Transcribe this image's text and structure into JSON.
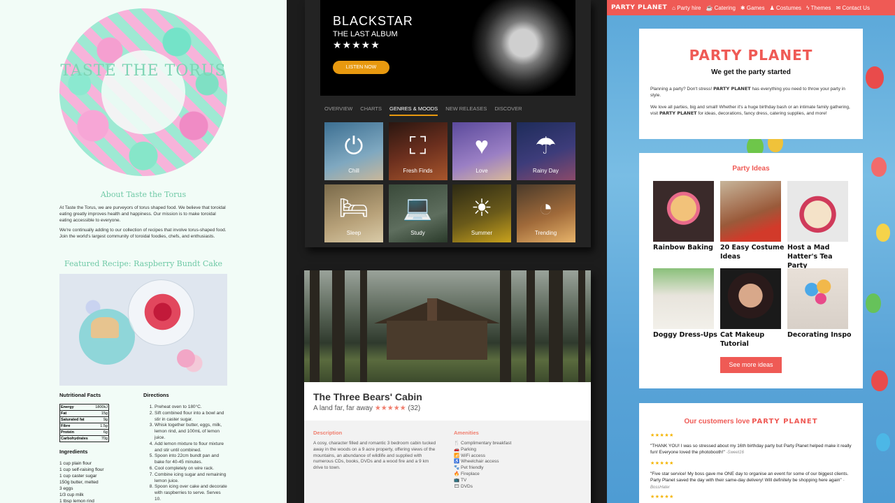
{
  "torus": {
    "hero_title": "TASTE THE TORUS",
    "about_heading": "About Taste the Torus",
    "about_p1": "At Taste the Torus, we are purveyors of torus shaped food. We believe that toroidal eating greatly improves health and happiness. Our mission is to make toroidal eating accessible to everyone.",
    "about_p2": "We're continually adding to our collection of recipes that involve torus-shaped food. Join the world's largest community of toroidal foodies, chefs, and enthusiasts.",
    "featured_heading": "Featured Recipe: Raspberry Bundt Cake",
    "nutrition_title": "Nutritional Facts",
    "nutrition": [
      {
        "label": "Energy",
        "value": "1800kJ"
      },
      {
        "label": "Fat",
        "value": "15g"
      },
      {
        "label": "Saturated fat",
        "value": "9g"
      },
      {
        "label": "Fibre",
        "value": "1.5g"
      },
      {
        "label": "Protein",
        "value": "6g"
      },
      {
        "label": "Carbohydrates",
        "value": "70g"
      }
    ],
    "ingredients_title": "Ingredients",
    "ingredients": [
      "1 cup plain flour",
      "1 cup self-raising flour",
      "1 cup caster sugar",
      "150g butter, melted",
      "3 eggs",
      "1/3 cup milk",
      "1 tbsp lemon rind"
    ],
    "directions_title": "Directions",
    "directions": [
      "Preheat oven to 180°C.",
      "Sift combined flour into a bowl and stir in caster sugar.",
      "Whisk together butter, eggs, milk, lemon rind, and 100mL of lemon juice.",
      "Add lemon mixture to flour mixture and stir until combined.",
      "Spoon into 22cm bundt pan and bake for 40-45 minutes.",
      "Cool completely on wire rack.",
      "Combine icing sugar and remaining lemon juice.",
      "Spoon icing over cake and decorate with raspberries to serve. Serves 10."
    ]
  },
  "music": {
    "album_title": "BLACKSTAR",
    "album_sub": "THE LAST ALBUM",
    "album_stars": "★★★★★",
    "listen_label": "LISTEN NOW",
    "tabs": [
      "OVERVIEW",
      "CHARTS",
      "GENRES & MOODS",
      "NEW RELEASES",
      "DISCOVER"
    ],
    "active_tab": "GENRES & MOODS",
    "accent": "#e8990f",
    "tiles": [
      {
        "label": "Chill",
        "icon": "power-icon",
        "glyph": "⏻"
      },
      {
        "label": "Fresh Finds",
        "icon": "binoculars-icon",
        "glyph": "⛶"
      },
      {
        "label": "Love",
        "icon": "heart-icon",
        "glyph": "♥"
      },
      {
        "label": "Rainy Day",
        "icon": "umbrella-icon",
        "glyph": "☂"
      },
      {
        "label": "Sleep",
        "icon": "bed-icon",
        "glyph": "🛏"
      },
      {
        "label": "Study",
        "icon": "laptop-icon",
        "glyph": "💻"
      },
      {
        "label": "Summer",
        "icon": "sun-icon",
        "glyph": "☀"
      },
      {
        "label": "Trending",
        "icon": "gauge-icon",
        "glyph": "◔"
      }
    ]
  },
  "cabin": {
    "name": "The Three Bears' Cabin",
    "tagline": "A land far, far away",
    "rating_stars": "★★★★★",
    "rating_count": "(32)",
    "description_title": "Description",
    "description": "A cosy, character filled and romantic 3 bedroom cabin tucked away in the woods on a 9 acre property, offering views of the mountains, an abundance of wildlife and supplied with numerous CDs, books, DVDs and a wood fire and a 9 km drive to town.",
    "amenities_title": "Amenities",
    "amenities": [
      {
        "label": "Complimentary breakfast",
        "icon": "cutlery-icon",
        "glyph": "🍴"
      },
      {
        "label": "Parking",
        "icon": "car-icon",
        "glyph": "🚗"
      },
      {
        "label": "WiFi access",
        "icon": "wifi-icon",
        "glyph": "📶"
      },
      {
        "label": "Wheelchair access",
        "icon": "wheelchair-icon",
        "glyph": "♿"
      },
      {
        "label": "Pet friendly",
        "icon": "paw-icon",
        "glyph": "🐾"
      },
      {
        "label": "Fireplace",
        "icon": "fire-icon",
        "glyph": "🔥"
      },
      {
        "label": "TV",
        "icon": "tv-icon",
        "glyph": "📺"
      },
      {
        "label": "DVDs",
        "icon": "film-icon",
        "glyph": "🎞"
      }
    ],
    "accent": "#f07e6e"
  },
  "party": {
    "brand": "PARTY PLANET",
    "nav": [
      {
        "label": "Party hire",
        "icon": "building-icon",
        "glyph": "⌂"
      },
      {
        "label": "Catering",
        "icon": "cake-icon",
        "glyph": "☕"
      },
      {
        "label": "Games",
        "icon": "puzzle-icon",
        "glyph": "✱"
      },
      {
        "label": "Costumes",
        "icon": "costume-icon",
        "glyph": "♟"
      },
      {
        "label": "Themes",
        "icon": "bolt-icon",
        "glyph": "ϟ"
      },
      {
        "label": "Contact Us",
        "icon": "envelope-icon",
        "glyph": "✉"
      }
    ],
    "hero_logo": "PARTY PLANET",
    "tagline": "We get the party started",
    "intro_p1_a": "Planning a party? Don't stress!",
    "intro_p1_brand": "PARTY PLANET",
    "intro_p1_b": "has everything you need to throw your party in style.",
    "intro_p2_a": "We love all parties, big and small! Whether it's a huge birthday bash or an intimate family gathering, visit",
    "intro_p2_brand": "PARTY PLANET",
    "intro_p2_b": "for ideas, decorations, fancy dress, catering supplies, and more!",
    "ideas_heading": "Party Ideas",
    "ideas": [
      {
        "caption": "Rainbow Baking"
      },
      {
        "caption": "20 Easy Costume Ideas"
      },
      {
        "caption": "Host a Mad Hatter's Tea Party"
      },
      {
        "caption": "Doggy Dress-Ups"
      },
      {
        "caption": "Cat Makeup Tutorial"
      },
      {
        "caption": "Decorating Inspo"
      }
    ],
    "more_label": "See more ideas",
    "reviews_heading_a": "Our customers love",
    "reviews_heading_brand": "PARTY PLANET",
    "reviews": [
      {
        "stars": "★★★★★",
        "text": "\"THANK YOU! I was so stressed about my 16th birthday party but Party Planet helped make it really fun! Everyone loved the photobooth!\"",
        "author": "-Sweet16"
      },
      {
        "stars": "★★★★★",
        "text": "\"Five star service! My boss gave me ONE day to organise an event for some of our biggest clients. Party Planet saved the day with their same-day delivery! Will definitely be shopping here again\"",
        "author": "-BossHater"
      },
      {
        "stars": "★★★★★",
        "text": "",
        "author": ""
      }
    ],
    "accent": "#ef5a55"
  }
}
